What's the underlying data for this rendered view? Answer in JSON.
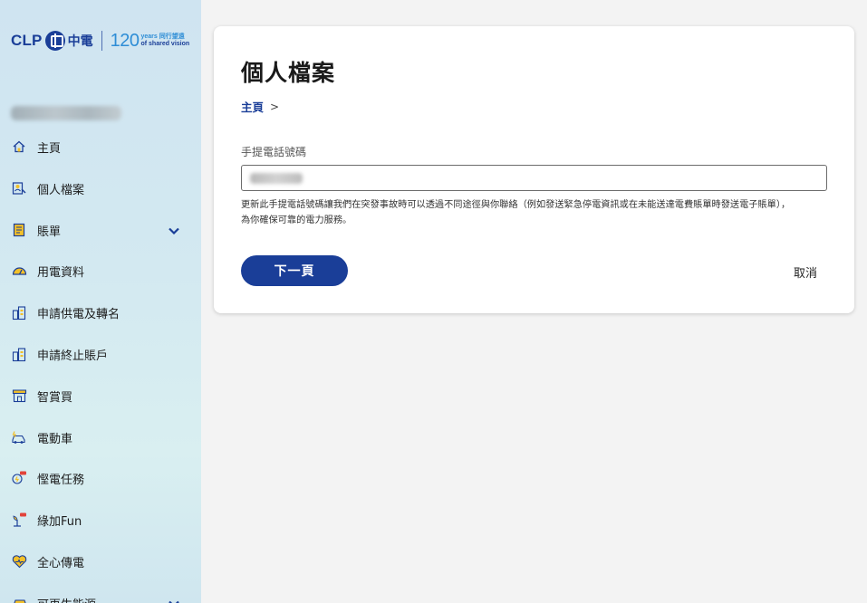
{
  "brand": {
    "clp": "CLP",
    "clp_cn": "中電",
    "anniversary_number": "120",
    "anniversary_line1": "years 同行望遠",
    "anniversary_line2": "of shared vision"
  },
  "sidebar": {
    "items": [
      {
        "label": "主頁",
        "icon": "home-icon"
      },
      {
        "label": "個人檔案",
        "icon": "profile-icon"
      },
      {
        "label": "賬單",
        "icon": "bill-icon",
        "expandable": true
      },
      {
        "label": "用電資料",
        "icon": "gauge-icon"
      },
      {
        "label": "申請供電及轉名",
        "icon": "building-icon"
      },
      {
        "label": "申請終止賬戶",
        "icon": "building-icon"
      },
      {
        "label": "智賞買",
        "icon": "shop-icon"
      },
      {
        "label": "電動車",
        "icon": "ev-car-icon"
      },
      {
        "label": "慳電任務",
        "icon": "mission-icon"
      },
      {
        "label": "綠加Fun",
        "icon": "plant-icon"
      },
      {
        "label": "全心傳電",
        "icon": "heart-icon"
      },
      {
        "label": "可再生能源",
        "icon": "solar-icon",
        "expandable": true
      }
    ]
  },
  "main": {
    "title": "個人檔案",
    "breadcrumb": {
      "home": "主頁",
      "separator": ">"
    },
    "phone_label": "手提電話號碼",
    "helper_line1": "更新此手提電話號碼讓我們在突發事故時可以透過不同途徑與你聯絡（例如發送緊急停電資訊或在未能送達電費賬單時發送電子賬單），",
    "helper_line2": "為你確保可靠的電力服務。",
    "next_button": "下一頁",
    "cancel_button": "取消"
  },
  "colors": {
    "brand_blue": "#1a3e98",
    "accent_blue": "#2e8dd6",
    "icon_yellow": "#f2c029"
  }
}
